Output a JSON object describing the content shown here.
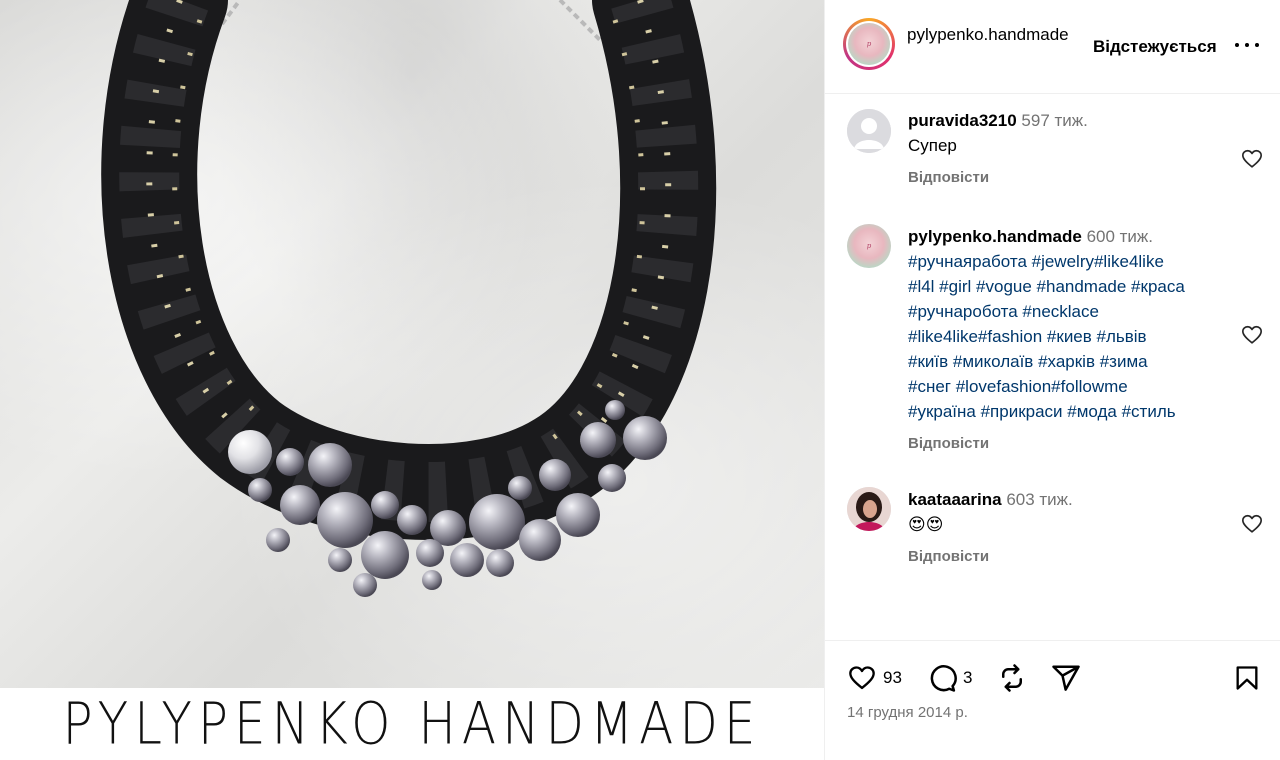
{
  "photo": {
    "brand_text": "PYLYPENKO HANDMADE"
  },
  "header": {
    "username": "pylypenko.handmade",
    "follow_status": "Відстежується",
    "more_icon": "more-horizontal-icon"
  },
  "comments": [
    {
      "username": "puravida3210",
      "time": "597 тиж.",
      "text": "Супер",
      "reply_label": "Відповісти",
      "avatar": "default-avatar-icon"
    },
    {
      "username": "pylypenko.handmade",
      "time": "600 тиж.",
      "tag_lines": [
        "#ручнаяработа #jewelry#like4like",
        "#l4l #girl #vogue #handmade #краса",
        "#ручнаробота #necklace",
        "#like4like#fashion #киев #львів",
        "#київ #миколаїв #харків #зима",
        "#снег #lovefashion#followme",
        "#україна #прикраси #мода #стиль"
      ],
      "reply_label": "Відповісти",
      "avatar": "brand-logo"
    },
    {
      "username": "kaataaarina",
      "time": "603 тиж.",
      "text": "😍😍",
      "reply_label": "Відповісти",
      "avatar": "profile-photo"
    }
  ],
  "actions": {
    "likes_count": "93",
    "comments_count": "3",
    "date": "14 грудня 2014 р.",
    "icons": [
      "heart-icon",
      "comment-icon",
      "repost-icon",
      "share-icon",
      "bookmark-icon"
    ]
  },
  "colors": {
    "hashtag": "#00376b",
    "muted": "#737373",
    "ring_gradient": [
      "#f9a825",
      "#e1306c",
      "#c13584"
    ]
  }
}
